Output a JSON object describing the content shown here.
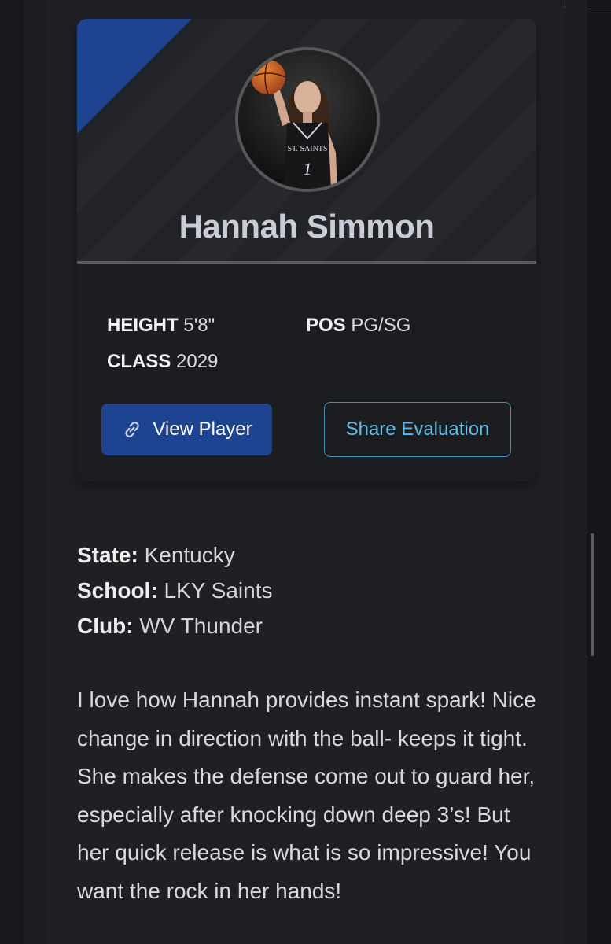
{
  "player": {
    "name": "Hannah Simmon",
    "photo_alt": "player-photo",
    "jersey_text": "ST. SAINTS",
    "jersey_number": "1"
  },
  "stats": {
    "height_label": "HEIGHT",
    "height_value": "5'8\"",
    "pos_label": "POS",
    "pos_value": "PG/SG",
    "class_label": "CLASS",
    "class_value": "2029"
  },
  "actions": {
    "view_player": "View Player",
    "share_evaluation": "Share Evaluation"
  },
  "details": {
    "state_label": "State:",
    "state_value": "Kentucky",
    "school_label": "School:",
    "school_value": "LKY Saints",
    "club_label": "Club:",
    "club_value": "WV Thunder"
  },
  "evaluation": {
    "text": "I love how Hannah provides instant spark! Nice change in direction with the ball- keeps it tight. She makes the defense come out to guard her, especially after knocking down deep 3’s! But her quick release is what is so impressive! You want the rock in her hands!"
  },
  "colors": {
    "accent_blue": "#1d4391",
    "link_blue": "#5fbde8",
    "background": "#1d1e21"
  },
  "icons": {
    "view_player_icon": "link-icon"
  }
}
